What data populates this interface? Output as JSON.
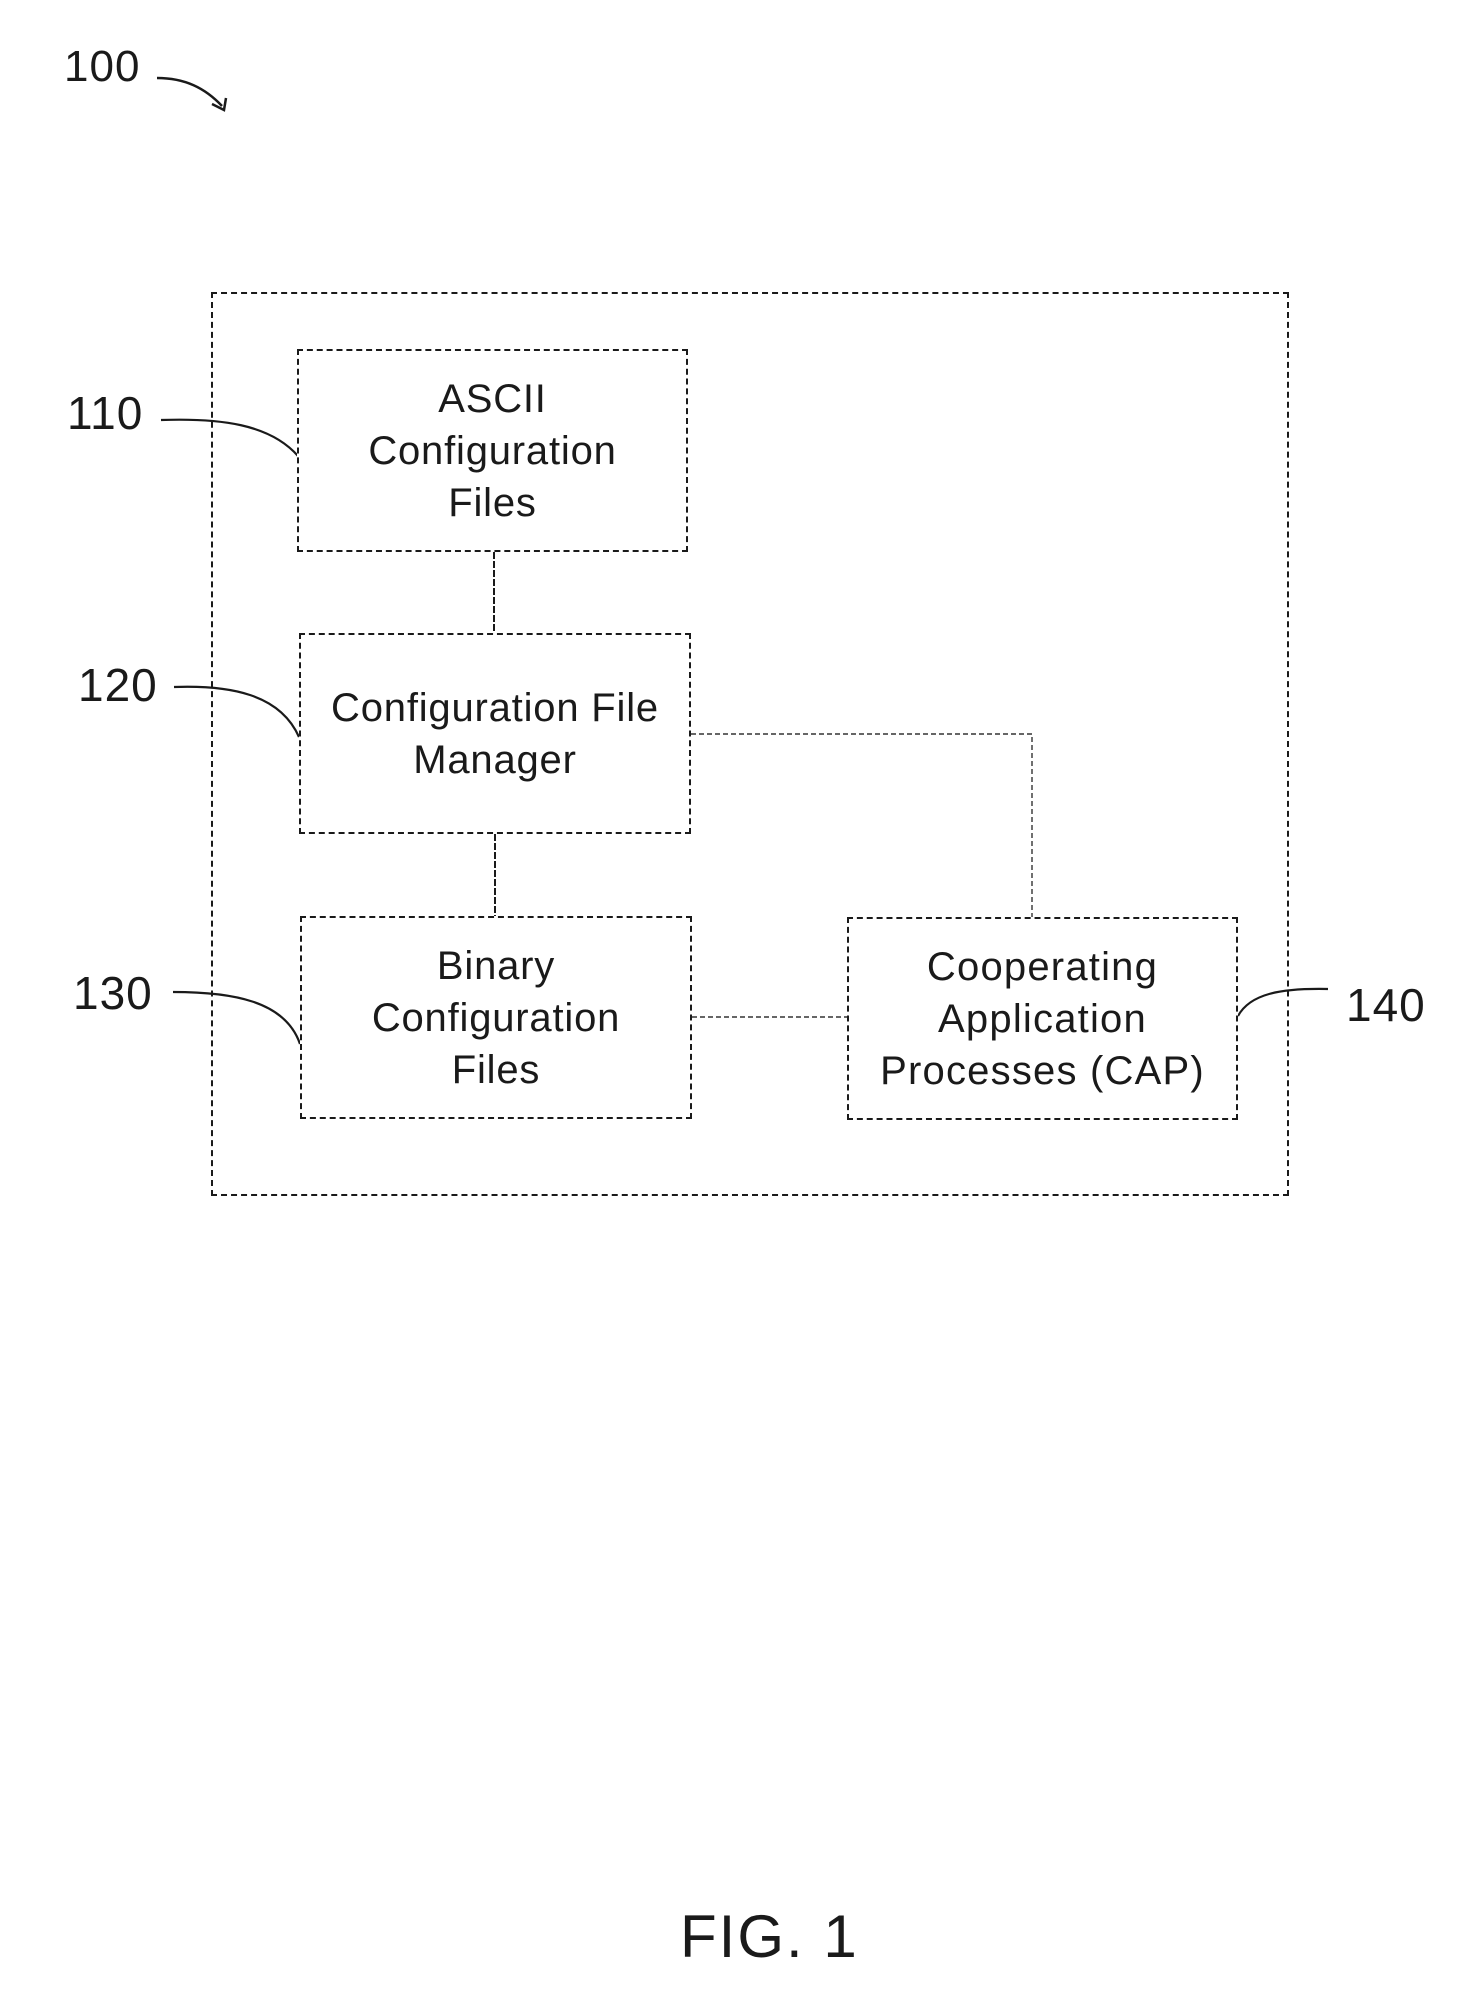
{
  "figure": {
    "caption": "FIG. 1",
    "system_ref": "100"
  },
  "blocks": [
    {
      "ref": "110",
      "label": "ASCII\nConfiguration\nFiles"
    },
    {
      "ref": "120",
      "label": "Configuration File\nManager"
    },
    {
      "ref": "130",
      "label": "Binary\nConfiguration\nFiles"
    },
    {
      "ref": "140",
      "label": "Cooperating\nApplication\nProcesses (CAP)"
    }
  ],
  "connections": [
    {
      "from": "110",
      "to": "120",
      "style": "solid"
    },
    {
      "from": "120",
      "to": "130",
      "style": "solid"
    },
    {
      "from": "120",
      "to": "140",
      "style": "dashed"
    },
    {
      "from": "130",
      "to": "140",
      "style": "dashed"
    }
  ]
}
